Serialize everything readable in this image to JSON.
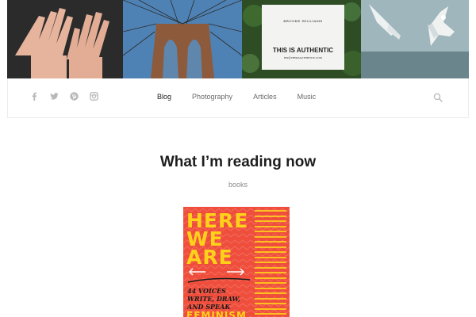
{
  "banner": {
    "photos": [
      "hands-photo",
      "bridge-photo",
      "business-card-photo",
      "seagulls-photo"
    ],
    "card": {
      "name": "BROOKE WILLIAMS",
      "headline": "THIS IS AUTHENTIC",
      "handle": "BW@THISISAUTHENTIC.COM"
    }
  },
  "social": {
    "icons": [
      "facebook-icon",
      "twitter-icon",
      "pinterest-icon",
      "instagram-icon"
    ]
  },
  "nav": {
    "items": [
      {
        "label": "Blog",
        "active": true
      },
      {
        "label": "Photography"
      },
      {
        "label": "Articles"
      },
      {
        "label": "Music"
      }
    ],
    "search_icon": "search-icon"
  },
  "post": {
    "title": "What I’m reading now",
    "category": "books"
  },
  "book": {
    "title_lines": [
      "HERE",
      "WE",
      "ARE"
    ],
    "subtitle": "44 VOICES WRITE, DRAW, AND SPEAK",
    "bottom_text": "FEMINISM"
  },
  "colors": {
    "book_red": "#ef4e3d",
    "book_yellow": "#ffd21a",
    "nav_active": "#222222",
    "nav_text": "#6a6a6a",
    "icon_gray": "#b8b8b8"
  }
}
